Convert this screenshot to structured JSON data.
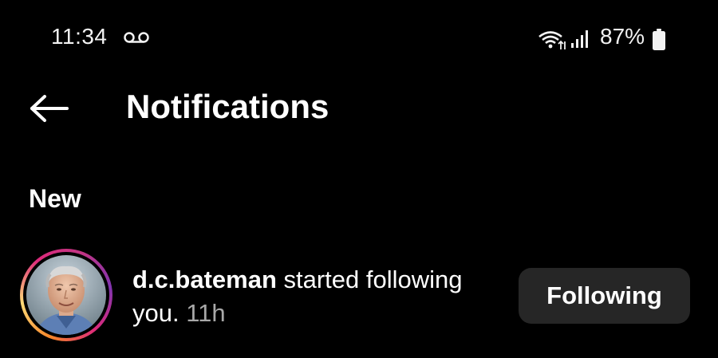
{
  "status_bar": {
    "time": "11:34",
    "battery_percent": "87%",
    "icons": [
      "voicemail-icon",
      "wifi-icon",
      "signal-icon",
      "battery-icon"
    ]
  },
  "header": {
    "back_icon": "arrow-left-icon",
    "title": "Notifications"
  },
  "sections": [
    {
      "heading": "New",
      "items": [
        {
          "username": "d.c.bateman",
          "message": " started following you. ",
          "time_ago": "11h",
          "button_label": "Following"
        }
      ]
    }
  ],
  "colors": {
    "background": "#000000",
    "text": "#ffffff",
    "secondary_text": "#a8a8a8",
    "button_bg": "#262626",
    "story_ring": [
      "#f58529",
      "#feda77",
      "#dd2a7b",
      "#8134af"
    ]
  }
}
